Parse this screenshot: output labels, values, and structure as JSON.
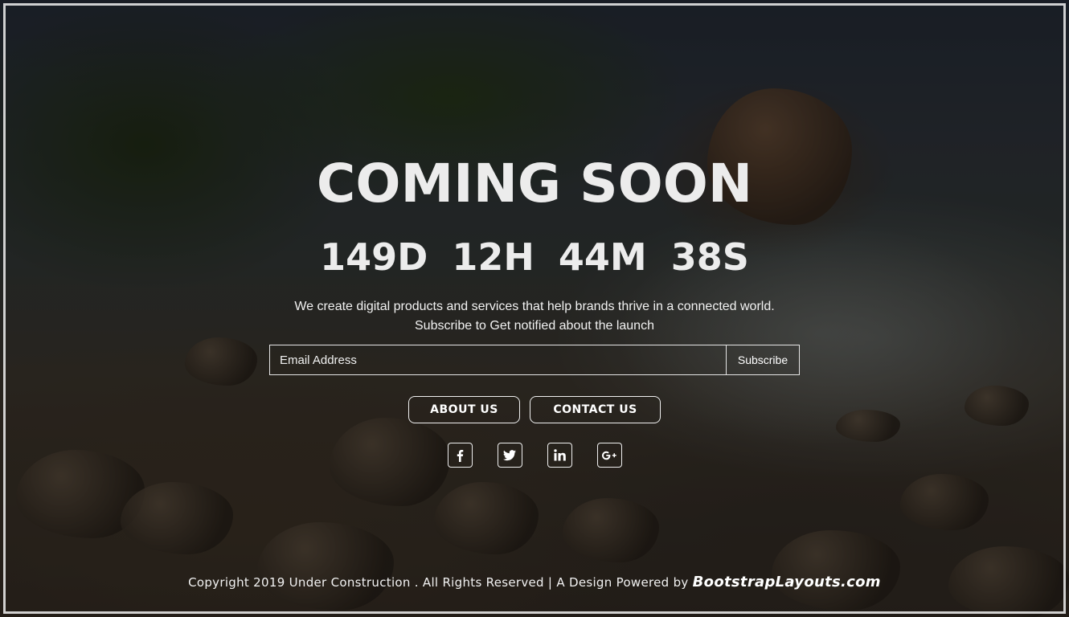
{
  "hero": {
    "title": "COMING SOON",
    "countdown": {
      "days": "149D",
      "hours": "12H",
      "minutes": "44M",
      "seconds": "38S"
    },
    "tagline": "We create digital products and services that help brands thrive in a connected world.",
    "subline": "Subscribe to Get notified about the launch"
  },
  "subscribe_form": {
    "email_placeholder": "Email Address",
    "email_value": "",
    "button_label": "Subscribe"
  },
  "nav_buttons": {
    "about_label": "ABOUT US",
    "contact_label": "CONTACT US"
  },
  "social": [
    {
      "icon": "facebook-icon"
    },
    {
      "icon": "twitter-icon"
    },
    {
      "icon": "linkedin-icon"
    },
    {
      "icon": "google-plus-icon"
    }
  ],
  "footer": {
    "text": "Copyright 2019 Under Construction . All Rights Reserved | A Design Powered by",
    "brand": "BootstrapLayouts.com"
  },
  "colors": {
    "text": "#ffffff",
    "border": "#f0f0f0",
    "overlay": "rgba(0,0,0,0.42)"
  }
}
